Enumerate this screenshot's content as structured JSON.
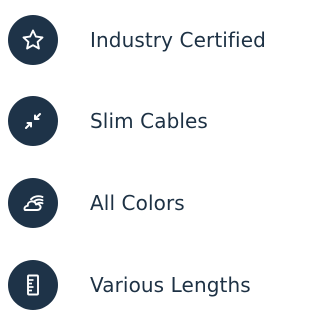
{
  "colors": {
    "icon_background": "#1e3348",
    "icon_foreground": "#ffffff",
    "label_text": "#1d3144",
    "page_background": "#ffffff"
  },
  "features": [
    {
      "label": "Industry Certified",
      "icon": "star-icon"
    },
    {
      "label": "Slim Cables",
      "icon": "compress-arrows-icon"
    },
    {
      "label": "All Colors",
      "icon": "rainbow-cloud-icon"
    },
    {
      "label": "Various Lengths",
      "icon": "ruler-icon"
    }
  ]
}
